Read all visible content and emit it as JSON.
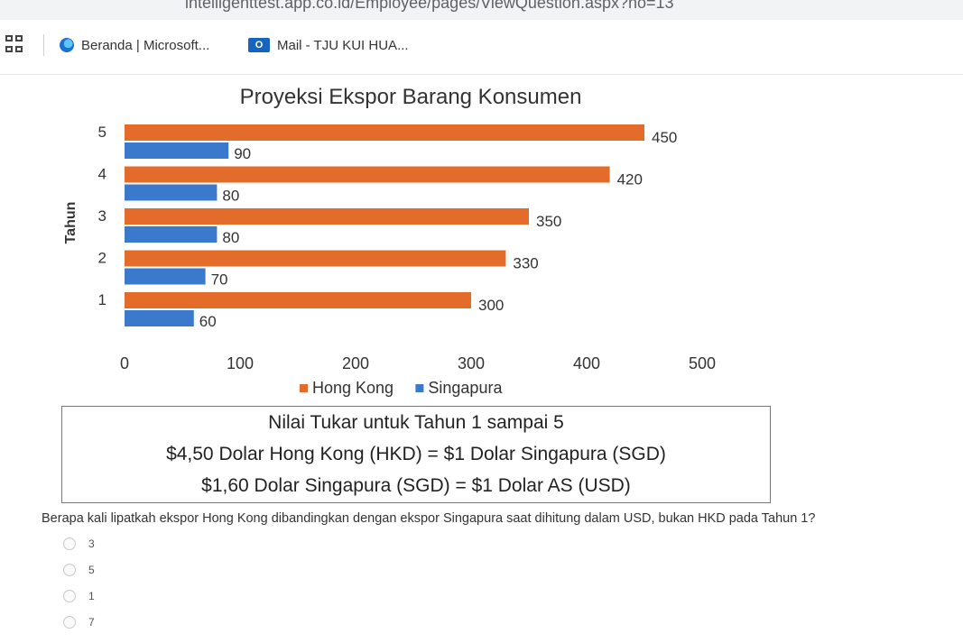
{
  "browser": {
    "address_url": "intelligenttest.app.co.id/Employee/pages/ViewQuestion.aspx?no=13",
    "bookmarks": [
      {
        "label": "Beranda | Microsoft...",
        "icon": "edge-icon"
      },
      {
        "label": "Mail - TJU KUI HUA...",
        "icon": "outlook-icon"
      }
    ]
  },
  "chart_data": {
    "type": "bar",
    "orientation": "horizontal",
    "title": "Proyeksi Ekspor Barang Konsumen",
    "ylabel": "Tahun",
    "xlabel": "",
    "categories": [
      "1",
      "2",
      "3",
      "4",
      "5"
    ],
    "series": [
      {
        "name": "Hong Kong",
        "color": "#e36c2b",
        "values": [
          300,
          330,
          350,
          420,
          450
        ]
      },
      {
        "name": "Singapura",
        "color": "#3a79cc",
        "values": [
          60,
          70,
          80,
          80,
          90
        ]
      }
    ],
    "xlim": [
      0,
      500
    ],
    "xticks": [
      "0",
      "100",
      "200",
      "300",
      "400",
      "500"
    ],
    "legend_position": "bottom",
    "grid": false
  },
  "rate_box": {
    "title": "Nilai Tukar untuk Tahun 1 sampai 5",
    "line1": "$4,50 Dolar Hong Kong (HKD) = $1 Dolar Singapura (SGD)",
    "line2": "$1,60 Dolar Singapura (SGD) = $1 Dolar AS (USD)"
  },
  "question": {
    "text": "Berapa kali lipatkah ekspor Hong Kong dibandingkan dengan ekspor Singapura saat dihitung dalam USD, bukan HKD pada Tahun 1?",
    "options": [
      "3",
      "5",
      "1",
      "7"
    ]
  }
}
